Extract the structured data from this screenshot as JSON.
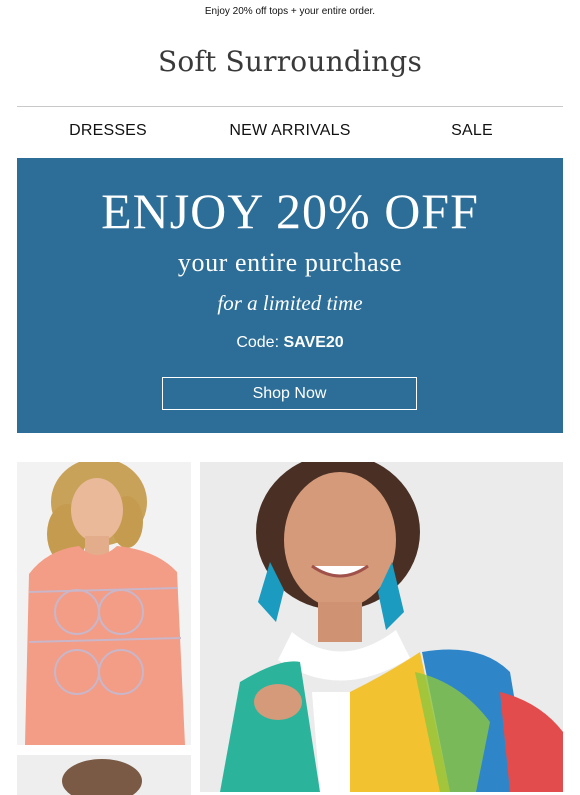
{
  "preheader": {
    "text": "Enjoy 20% off tops + your entire order."
  },
  "brand": {
    "name": "Soft Surroundings"
  },
  "nav": {
    "items": [
      {
        "label": "DRESSES"
      },
      {
        "label": "NEW ARRIVALS"
      },
      {
        "label": "SALE"
      }
    ]
  },
  "hero": {
    "title": "ENJOY 20% OFF",
    "subtitle": "your entire purchase",
    "tagline": "for a limited time",
    "code_prefix": "Code:",
    "code": "SAVE20",
    "button_label": "Shop Now",
    "background_color": "#2c6e97"
  },
  "products": {
    "left_image": "coral-sequin-top-photo",
    "right_image": "colorful-print-blouse-photo"
  }
}
